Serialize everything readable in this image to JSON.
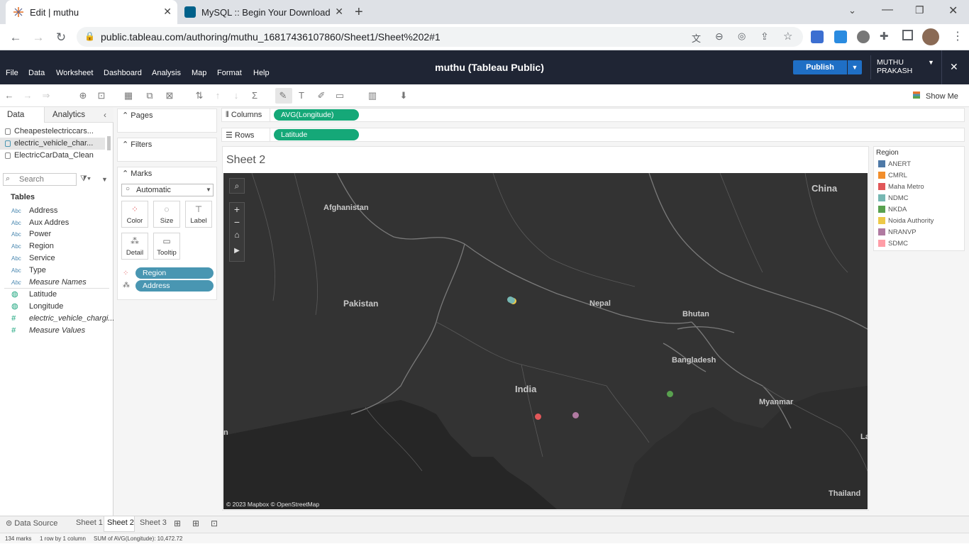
{
  "browser": {
    "tabs": [
      {
        "title": "Edit | muthu",
        "active": true
      },
      {
        "title": "MySQL :: Begin Your Download",
        "active": false
      }
    ],
    "url": "public.tableau.com/authoring/muthu_16817436107860/Sheet1/Sheet%202#1"
  },
  "header": {
    "menus": [
      "File",
      "Data",
      "Worksheet",
      "Dashboard",
      "Analysis",
      "Map",
      "Format",
      "Help"
    ],
    "title": "muthu (Tableau Public)",
    "publish_label": "Publish",
    "user_line1": "MUTHU",
    "user_line2": "PRAKASH"
  },
  "toolbar": {
    "show_me": "Show Me"
  },
  "data_pane": {
    "tab_data": "Data",
    "tab_analytics": "Analytics",
    "datasources": [
      "Cheapestelectriccars...",
      "electric_vehicle_char...",
      "ElectricCarData_Clean"
    ],
    "search_placeholder": "Search",
    "tables_label": "Tables",
    "dimensions": [
      {
        "type": "Abc",
        "name": "Address"
      },
      {
        "type": "Abc",
        "name": "Aux Addres"
      },
      {
        "type": "Abc",
        "name": "Power"
      },
      {
        "type": "Abc",
        "name": "Region"
      },
      {
        "type": "Abc",
        "name": "Service"
      },
      {
        "type": "Abc",
        "name": "Type"
      },
      {
        "type": "Abc",
        "name": "Measure Names"
      }
    ],
    "measures": [
      {
        "type": "geo",
        "name": "Latitude"
      },
      {
        "type": "geo",
        "name": "Longitude"
      },
      {
        "type": "#",
        "name": "electric_vehicle_chargi..."
      },
      {
        "type": "#",
        "name": "Measure Values"
      }
    ]
  },
  "cards": {
    "pages": "Pages",
    "filters": "Filters",
    "marks": "Marks",
    "mark_type": "Automatic",
    "mark_buttons": [
      "Color",
      "Size",
      "Label",
      "Detail",
      "Tooltip"
    ],
    "mark_pills": [
      "Region",
      "Address"
    ]
  },
  "shelves": {
    "columns_label": "Columns",
    "columns_pill": "AVG(Longitude)",
    "rows_label": "Rows",
    "rows_pill": "Latitude"
  },
  "sheet": {
    "title": "Sheet 2"
  },
  "legend": {
    "title": "Region",
    "items": [
      {
        "name": "ANERT",
        "color": "#4e79a7"
      },
      {
        "name": "CMRL",
        "color": "#f28e2b"
      },
      {
        "name": "Maha Metro",
        "color": "#e15759"
      },
      {
        "name": "NDMC",
        "color": "#76b7b2"
      },
      {
        "name": "NKDA",
        "color": "#59a14f"
      },
      {
        "name": "Noida Authority",
        "color": "#edc948"
      },
      {
        "name": "NRANVP",
        "color": "#b07aa1"
      },
      {
        "name": "SDMC",
        "color": "#ff9da7"
      }
    ]
  },
  "map": {
    "labels": [
      "China",
      "Afghanistan",
      "Pakistan",
      "Nepal",
      "Bhutan",
      "Bangladesh",
      "India",
      "Myanmar",
      "Thailand",
      "La",
      "n"
    ],
    "attribution": "© 2023 Mapbox  © OpenStreetMap"
  },
  "bottom": {
    "data_source": "Data Source",
    "sheets": [
      "Sheet 1",
      "Sheet 2",
      "Sheet 3"
    ],
    "active_sheet": "Sheet 2",
    "status_marks": "134 marks",
    "status_dims": "1 row by 1 column",
    "status_sum": "SUM of AVG(Longitude): 10,472.72"
  }
}
